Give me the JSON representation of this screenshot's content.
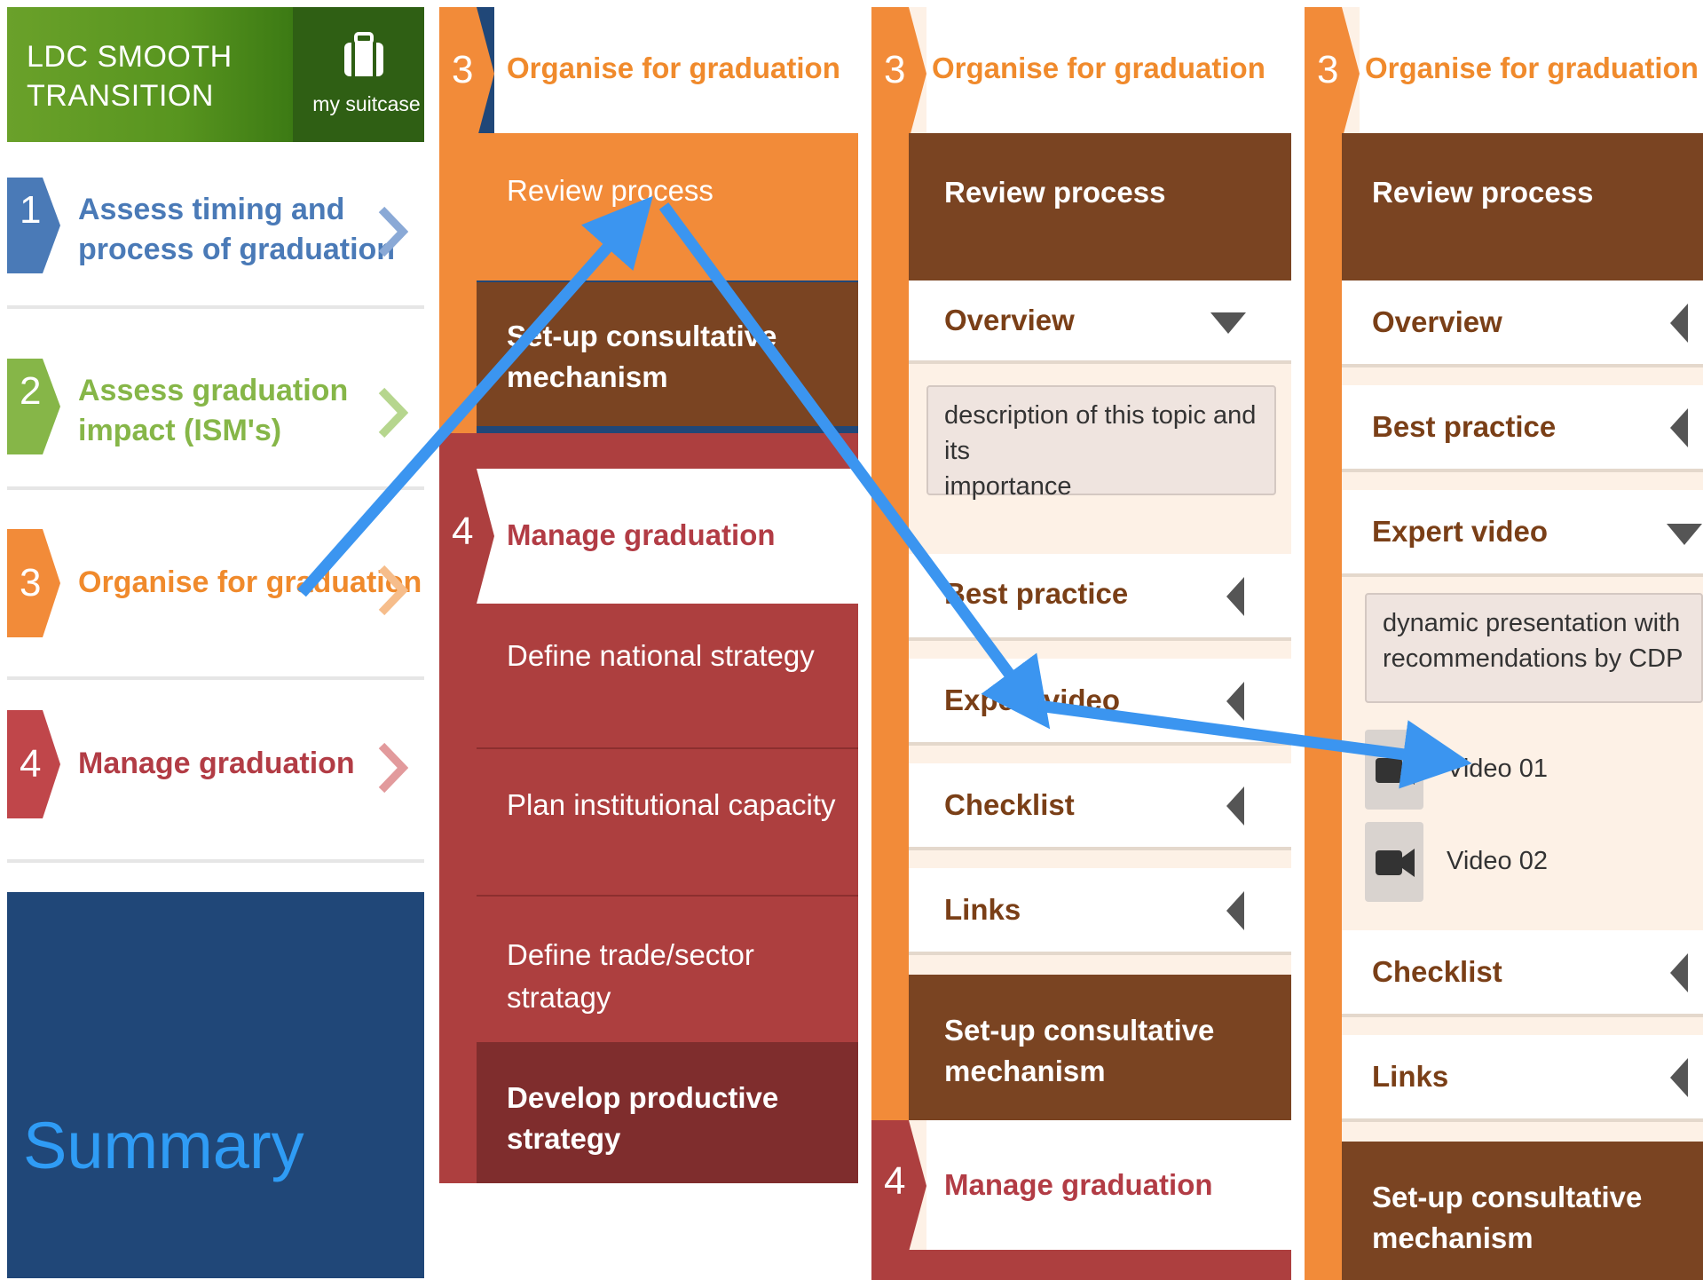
{
  "panel1": {
    "app_title_line1": "LDC SMOOTH",
    "app_title_line2": "TRANSITION",
    "suitcase_label": "my suitcase",
    "steps": [
      {
        "num": "1",
        "label_line1": "Assess timing and",
        "label_line2": "process of graduation",
        "color": "#4a7ab7",
        "chevron_color": "#8aa9d6"
      },
      {
        "num": "2",
        "label_line1": "Assess graduation",
        "label_line2": "impact (ISM's)",
        "color": "#86b648",
        "chevron_color": "#b6d68e"
      },
      {
        "num": "3",
        "label_line1": "Organise for graduation",
        "label_line2": "",
        "color": "#f28b39",
        "chevron_color": "#f6bd8b"
      },
      {
        "num": "4",
        "label_line1": "Manage graduation",
        "label_line2": "",
        "color": "#c0464a",
        "chevron_color": "#e29a9c"
      }
    ],
    "summary_label": "Summary"
  },
  "panel2": {
    "step3_num": "3",
    "step3_title": "Organise for graduation",
    "review_process": "Review process",
    "setup_line1": "Set-up consultative",
    "setup_line2": "mechanism",
    "step4_num": "4",
    "step4_title": "Manage graduation",
    "sub_items": [
      "Define national strategy",
      "Plan institutional capacity"
    ],
    "trade_line1": "Define trade/sector",
    "trade_line2": "stratagy",
    "develop_line1": "Develop productive",
    "develop_line2": "strategy"
  },
  "panel3": {
    "step3_num": "3",
    "step3_title": "Organise for graduation",
    "review_process": "Review process",
    "overview": "Overview",
    "overview_desc_line1": "description of this topic and its",
    "overview_desc_line2": "importance",
    "best_practice": "Best practice",
    "expert_video": "Expert video",
    "checklist": "Checklist",
    "links": "Links",
    "setup_line1": "Set-up consultative",
    "setup_line2": "mechanism",
    "step4_num": "4",
    "step4_title": "Manage graduation"
  },
  "panel4": {
    "step3_num": "3",
    "step3_title": "Organise for graduation",
    "review_process": "Review process",
    "overview": "Overview",
    "best_practice": "Best practice",
    "expert_video": "Expert video",
    "video_desc_line1": "dynamic presentation with",
    "video_desc_line2": "recommendations by CDP",
    "videos": [
      "Video 01",
      "Video 02"
    ],
    "checklist": "Checklist",
    "links": "Links",
    "setup_line1": "Set-up consultative",
    "setup_line2": "mechanism"
  },
  "colors": {
    "orange": "#f28b39",
    "brown": "#7a4422",
    "red": "#ad3f3f",
    "dark_red": "#7f2d2d",
    "navy": "#204778",
    "arrow_blue": "#3b95f0"
  }
}
